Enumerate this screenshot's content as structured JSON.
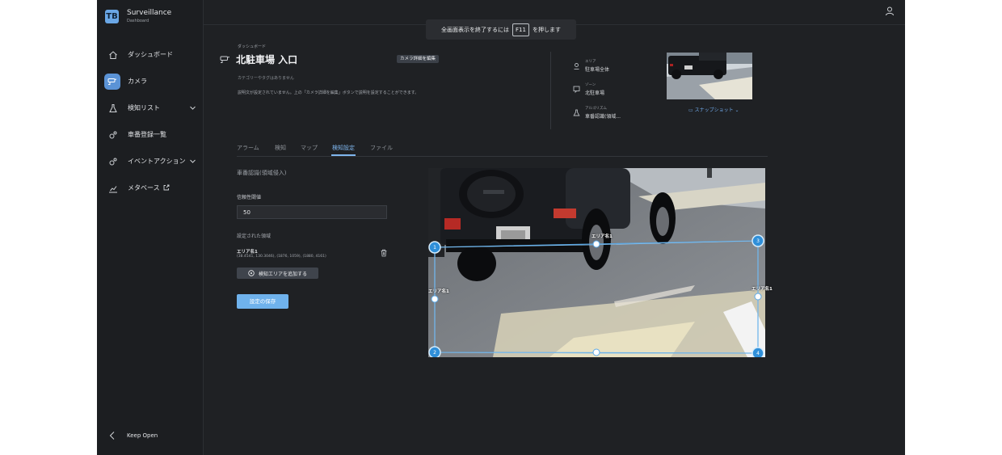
{
  "brand": {
    "logo": "TB",
    "title": "Surveillance",
    "subtitle": "Dashboard"
  },
  "sidebar": {
    "items": [
      {
        "label": "ダッシュボード",
        "icon": "home-icon"
      },
      {
        "label": "カメラ",
        "icon": "camera-icon",
        "active": true
      },
      {
        "label": "検知リスト",
        "icon": "flask-icon",
        "expandable": true
      },
      {
        "label": "車番登録一覧",
        "icon": "gear-person-icon"
      },
      {
        "label": "イベントアクション",
        "icon": "gear-person-icon",
        "expandable": true
      },
      {
        "label": "メタベース",
        "icon": "chart-icon",
        "external": true
      }
    ],
    "keep_open": "Keep Open"
  },
  "fullscreen_notice": {
    "before": "全画面表示を終了するには",
    "key": "F11",
    "after": "を押します"
  },
  "header": {
    "breadcrumb": "ダッシュボード",
    "title": "北駐車場 入口",
    "edit_button": "カメラ詳細を編集",
    "no_category": "カテゴリーやタグはありません",
    "description": "説明文が設定されていません。上の「カメラ詳細を編集」ボタンで説明を設定することができます。"
  },
  "info": [
    {
      "key": "エリア",
      "value": "駐車場全体",
      "icon": "location-icon"
    },
    {
      "key": "ゾーン",
      "value": "北駐車場",
      "icon": "zone-icon"
    },
    {
      "key": "アルゴリズム",
      "value": "車番認識(領域...",
      "icon": "flask-icon"
    }
  ],
  "snapshot_label": "スナップショット",
  "tabs": [
    "アラーム",
    "検知",
    "マップ",
    "検知設定",
    "ファイル"
  ],
  "active_tab": "検知設定",
  "detection": {
    "section_title": "車番認識(領域侵入)",
    "threshold_label": "信頼性閾値",
    "threshold_value": "50",
    "regions_label": "設定された領域",
    "region_name": "エリア名1",
    "region_coords": "(38.4541, 130.3046), (1876, 1059), (1880, 4161)",
    "add_area_button": "検知エリアを追加する",
    "save_button": "設定の保存"
  },
  "camera_view": {
    "region_labels": [
      "エリア名1",
      "エリア名1",
      "エリア名1"
    ],
    "points": [
      "1",
      "2",
      "3",
      "4"
    ]
  },
  "colors": {
    "accent": "#6fb2ec",
    "background": "#1f2124",
    "sidebar": "#1c1e21"
  }
}
